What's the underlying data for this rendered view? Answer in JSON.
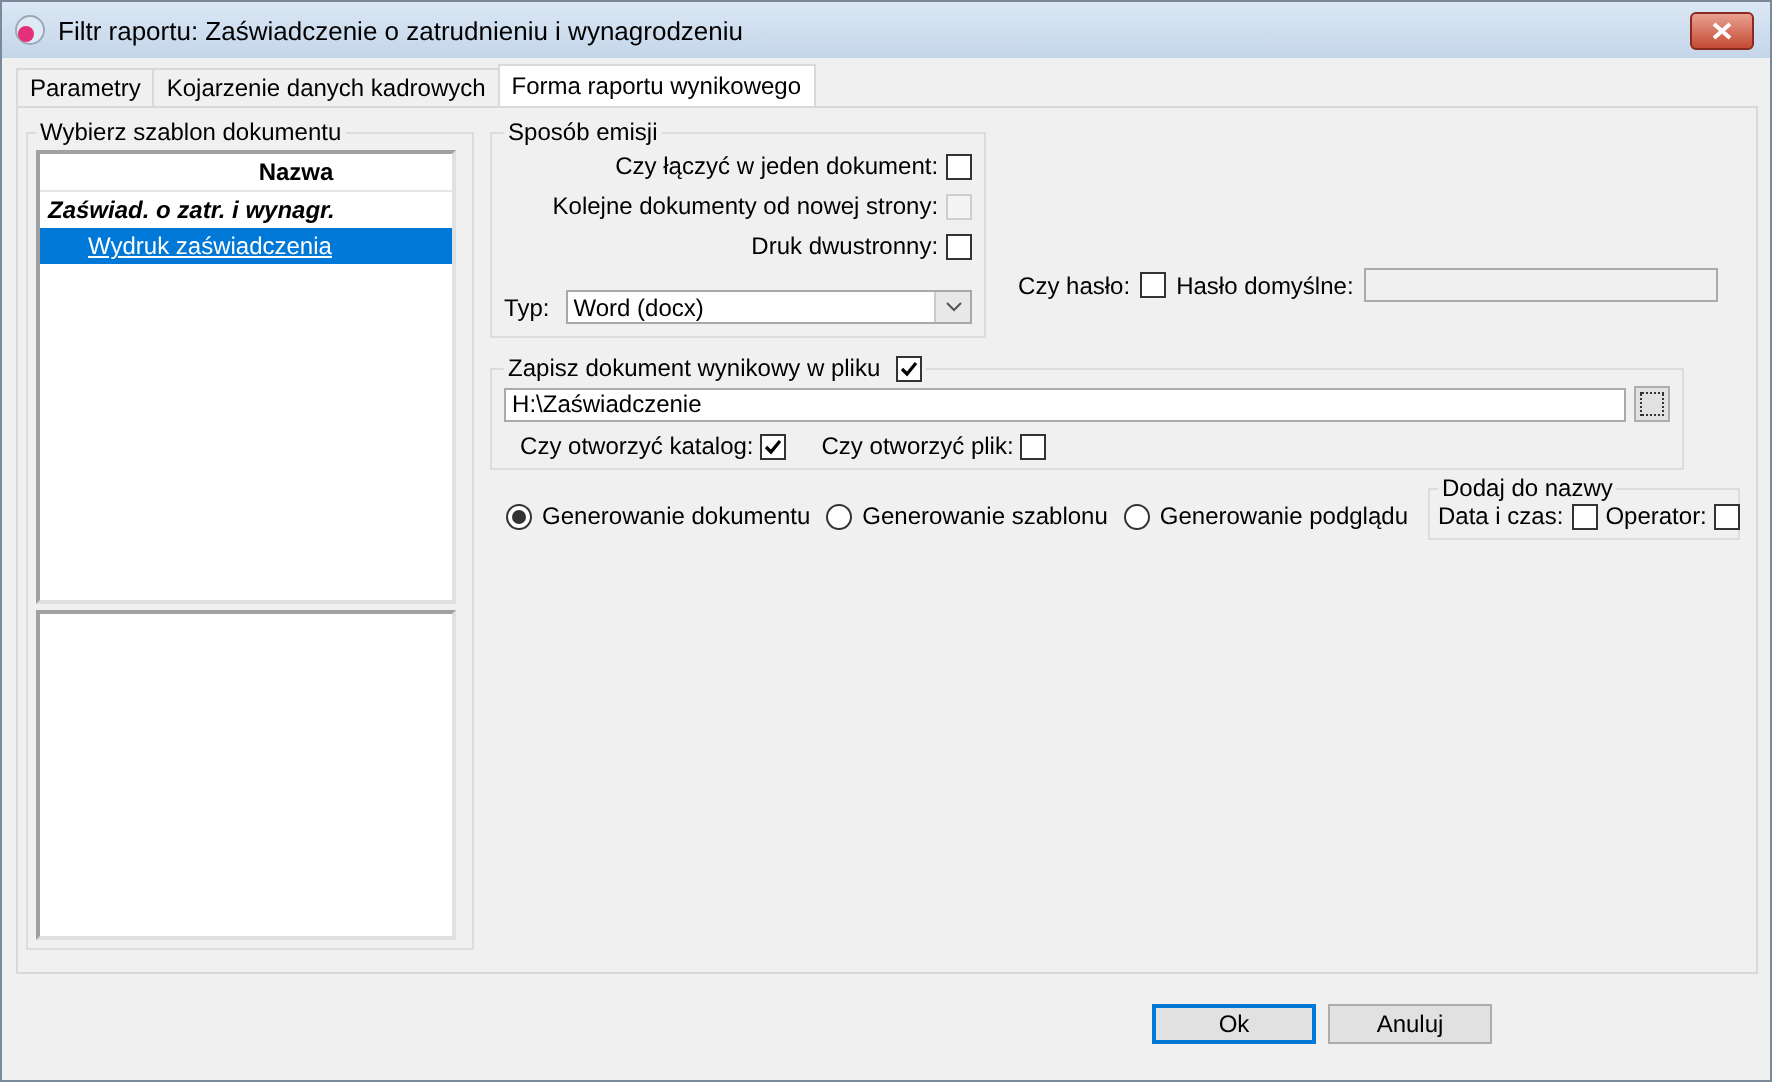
{
  "window": {
    "title": "Filtr raportu: Zaświadczenie o zatrudnieniu i wynagrodzeniu"
  },
  "tabs": [
    {
      "label": "Parametry",
      "selected": false
    },
    {
      "label": "Kojarzenie danych kadrowych",
      "selected": false
    },
    {
      "label": "Forma raportu wynikowego",
      "selected": true
    }
  ],
  "template_group": {
    "title": "Wybierz szablon dokumentu",
    "column_header": "Nazwa",
    "tree": [
      {
        "label": "Zaświad. o zatr. i wynagr.",
        "selected": false,
        "children": [
          {
            "label": "Wydruk zaświadczenia",
            "selected": true
          }
        ]
      }
    ]
  },
  "emission": {
    "title": "Sposób emisji",
    "options": [
      {
        "label": "Czy łączyć w jeden dokument:",
        "checked": false,
        "disabled": false
      },
      {
        "label": "Kolejne dokumenty od nowej strony:",
        "checked": false,
        "disabled": true
      },
      {
        "label": "Druk dwustronny:",
        "checked": false,
        "disabled": false
      }
    ],
    "type": {
      "label": "Typ:",
      "value": "Word (docx)"
    }
  },
  "password": {
    "label": "Czy hasło:",
    "checked": false,
    "default_label": "Hasło domyślne:"
  },
  "save": {
    "label": "Zapisz dokument wynikowy w pliku",
    "checked": true,
    "path": "H:\\Zaświadczenie",
    "options": [
      {
        "label": "Czy otworzyć katalog:",
        "checked": true
      },
      {
        "label": "Czy otworzyć plik:",
        "checked": false
      }
    ]
  },
  "modes": [
    {
      "label": "Generowanie dokumentu",
      "selected": true
    },
    {
      "label": "Generowanie szablonu",
      "selected": false
    },
    {
      "label": "Generowanie podglądu",
      "selected": false
    }
  ],
  "add_to_name": {
    "title": "Dodaj do nazwy",
    "options": [
      {
        "label": "Data i czas:",
        "checked": false
      },
      {
        "label": "Operator:",
        "checked": false
      }
    ]
  },
  "buttons": [
    {
      "label": "Ok",
      "default": true
    },
    {
      "label": "Anuluj",
      "default": false
    }
  ]
}
